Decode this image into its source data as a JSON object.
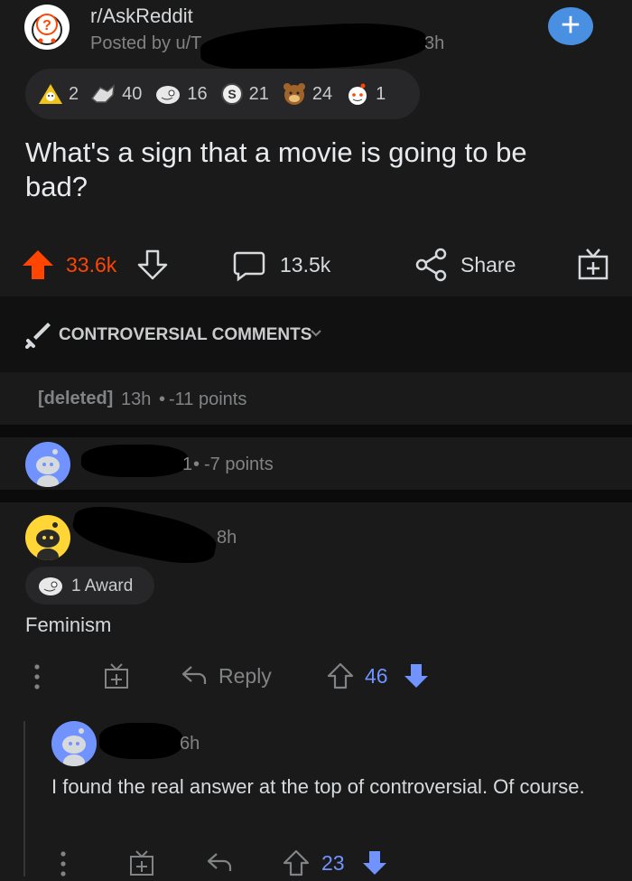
{
  "post": {
    "subreddit": "r/AskReddit",
    "posted_by": "Posted by u/T",
    "age": "3h",
    "awards": [
      {
        "icon": "wholesome-award-icon",
        "count": "2"
      },
      {
        "icon": "helpful-award-icon",
        "count": "40"
      },
      {
        "icon": "silver-award-icon",
        "count": "16"
      },
      {
        "icon": "gold-coin-award-icon",
        "count": "21"
      },
      {
        "icon": "bear-award-icon",
        "count": "24"
      },
      {
        "icon": "snoo-award-icon",
        "count": "1"
      }
    ],
    "title": "What's a sign that a movie is going to be bad?",
    "upvotes": "33.6k",
    "comments": "13.5k",
    "share_label": "Share"
  },
  "sort": {
    "label": "CONTROVERSIAL COMMENTS"
  },
  "comments": [
    {
      "author": "[deleted]",
      "age": "13h",
      "points": "-11 points"
    },
    {
      "age_fragment": "1",
      "points": "-7 points"
    },
    {
      "age": "8h",
      "award": "1 Award",
      "body": "Feminism",
      "reply_label": "Reply",
      "score": "46"
    },
    {
      "age": "6h",
      "body": "I found the real answer at the top of controversial. Of course.",
      "score": "23"
    }
  ],
  "colors": {
    "upvote": "#ff4500",
    "downvote": "#7193ff",
    "accent": "#0079d3",
    "background": "#1a1a1b"
  }
}
